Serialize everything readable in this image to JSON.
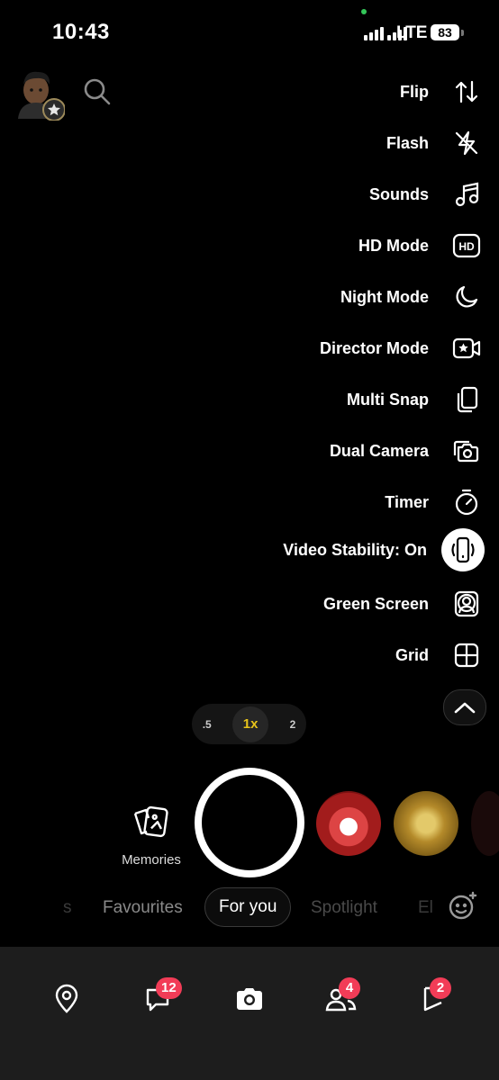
{
  "status_bar": {
    "time": "10:43",
    "network": "LTE",
    "battery": "83"
  },
  "right_menu": [
    {
      "label": "Flip",
      "icon": "flip-camera-icon"
    },
    {
      "label": "Flash",
      "icon": "flash-off-icon"
    },
    {
      "label": "Sounds",
      "icon": "music-note-icon"
    },
    {
      "label": "HD Mode",
      "icon": "hd-icon"
    },
    {
      "label": "Night Mode",
      "icon": "moon-icon"
    },
    {
      "label": "Director Mode",
      "icon": "video-star-icon"
    },
    {
      "label": "Multi Snap",
      "icon": "multi-snap-icon"
    },
    {
      "label": "Dual Camera",
      "icon": "dual-camera-icon"
    },
    {
      "label": "Timer",
      "icon": "timer-icon"
    },
    {
      "label": "Video Stability: On",
      "icon": "phone-stability-icon"
    },
    {
      "label": "Green Screen",
      "icon": "green-screen-icon"
    },
    {
      "label": "Grid",
      "icon": "grid-icon"
    }
  ],
  "zoom": {
    "options": [
      ".5",
      "1x",
      "2"
    ],
    "selected": "1x"
  },
  "memories_label": "Memories",
  "tabs": [
    "s",
    "Favourites",
    "For you",
    "Spotlight",
    "El"
  ],
  "active_tab": "For you",
  "bottom_nav": {
    "chat_badge": "12",
    "friends_badge": "4",
    "stories_badge": "2"
  }
}
